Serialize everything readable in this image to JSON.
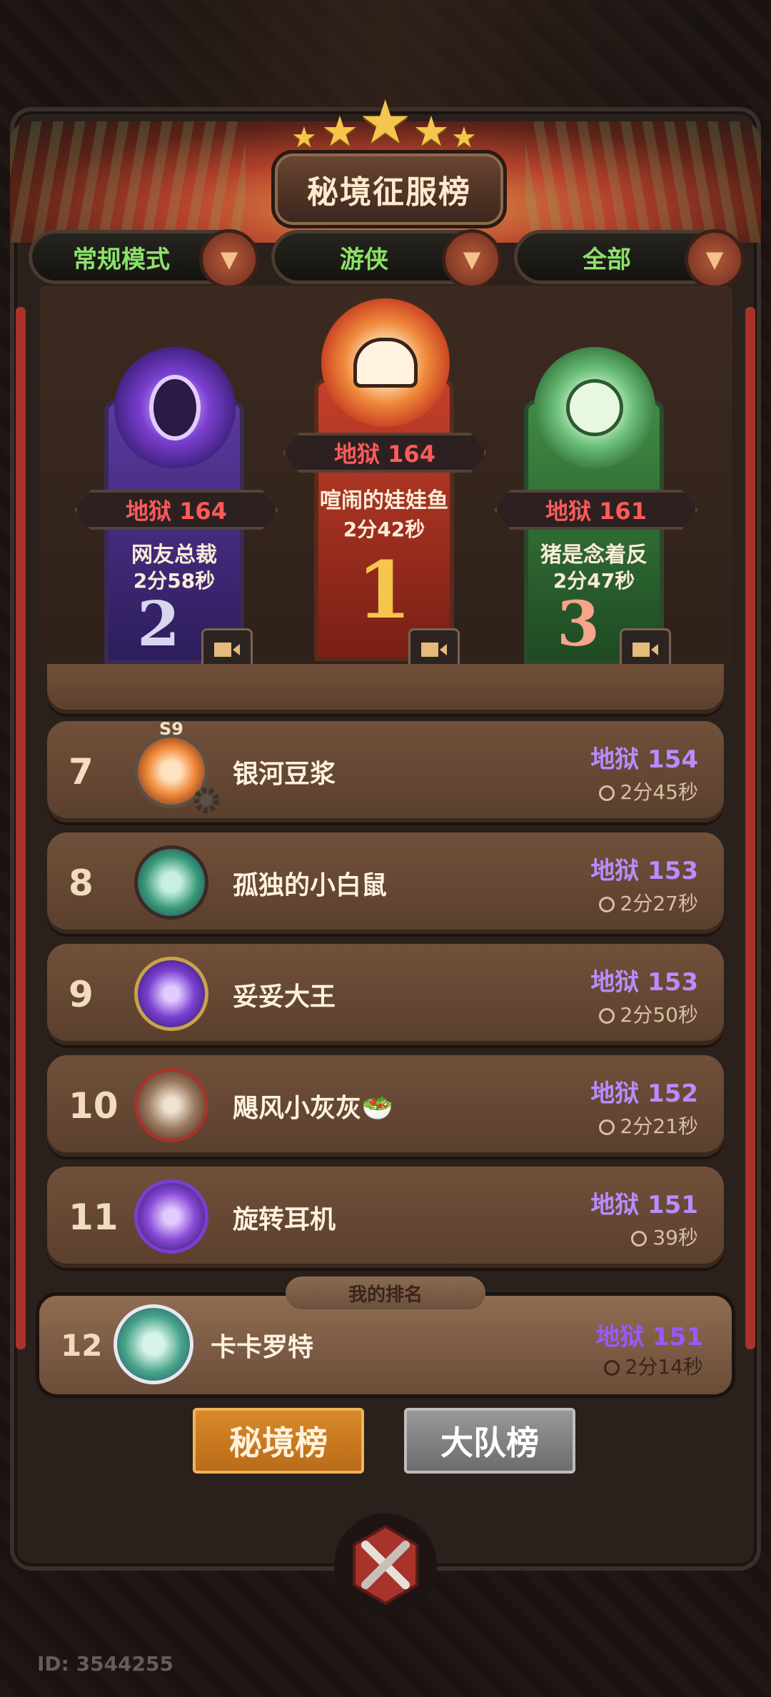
{
  "header": {
    "title": "秘境征服榜"
  },
  "filters": [
    {
      "label": "常规模式",
      "arrow": "▼"
    },
    {
      "label": "游侠",
      "arrow": "▼"
    },
    {
      "label": "全部",
      "arrow": "▼"
    }
  ],
  "podium": {
    "first": {
      "level": "地狱 164",
      "name": "喧闹的娃娃鱼",
      "time": "2分42秒",
      "rank": "1"
    },
    "second": {
      "level": "地狱 164",
      "name": "网友总裁",
      "time": "2分58秒",
      "rank": "2"
    },
    "third": {
      "level": "地狱 161",
      "name": "猪是念着反",
      "time": "2分47秒",
      "rank": "3"
    }
  },
  "avatar_badge": "S9",
  "rows": [
    {
      "rank": "7",
      "name": "银河豆浆",
      "level": "地狱 154",
      "time": "2分45秒"
    },
    {
      "rank": "8",
      "name": "孤独的小白鼠",
      "level": "地狱 153",
      "time": "2分27秒"
    },
    {
      "rank": "9",
      "name": "妥妥大王",
      "level": "地狱 153",
      "time": "2分50秒"
    },
    {
      "rank": "10",
      "name": "飓风小灰灰🥗",
      "level": "地狱 152",
      "time": "2分21秒"
    },
    {
      "rank": "11",
      "name": "旋转耳机",
      "level": "地狱 151",
      "time": "39秒"
    }
  ],
  "my_rank": {
    "tag": "我的排名",
    "rank": "12",
    "name": "卡卡罗特",
    "level": "地狱 151",
    "time": "2分14秒"
  },
  "tabs": {
    "secret": "秘境榜",
    "team": "大队榜"
  },
  "footer": {
    "id": "ID: 3544255"
  },
  "colors": {
    "level_purple": "#b98cff",
    "level_red": "#ff5a5a",
    "filter_green": "#8ce16a"
  }
}
